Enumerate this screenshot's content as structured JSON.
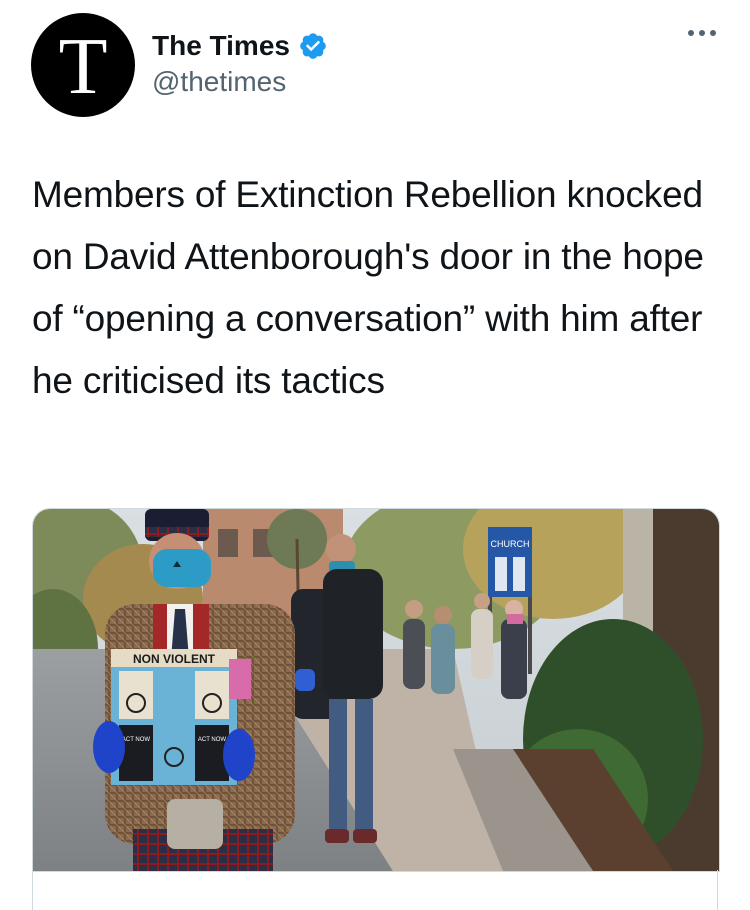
{
  "account": {
    "avatar_letter": "T",
    "display_name": "The Times",
    "handle": "@thetimes",
    "verified": true
  },
  "tweet": {
    "text": "Members of Extinction Rebellion knocked on David Attenborough's door in the hope of “opening a conversation” with him after he criticised its tactics"
  },
  "media": {
    "box_heading": "NON VIOLENT",
    "box_sign_left": "ACT NOW TO STOP SHIPPING DISASTER",
    "box_sign_right": "ACT NOW TO STOP SHIPPING DISASTER",
    "street_sign": "CHURCH"
  },
  "icons": {
    "verified": "verified-badge-icon",
    "more": "more-horizontal-icon"
  },
  "colors": {
    "verified_blue": "#1d9bf0",
    "text": "#0f1419",
    "secondary": "#536471"
  }
}
